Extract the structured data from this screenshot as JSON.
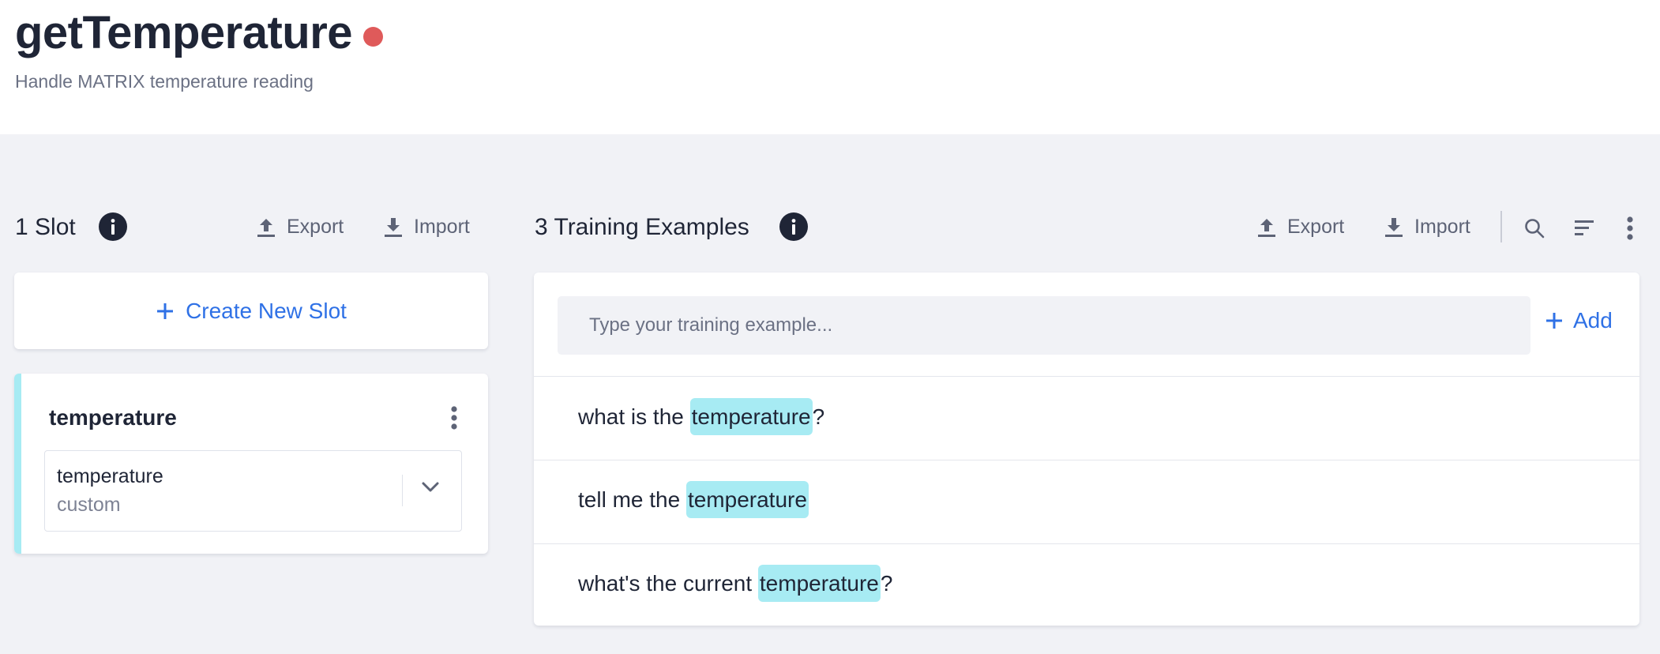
{
  "header": {
    "title": "getTemperature",
    "subtitle": "Handle MATRIX temperature reading",
    "status_color": "#df5a5a"
  },
  "slots_section": {
    "title": "1 Slot",
    "export_label": "Export",
    "import_label": "Import",
    "create_label": "Create New Slot",
    "slot": {
      "name": "temperature",
      "type_value": "temperature",
      "type_kind": "custom",
      "accent_color": "#a7ebf3"
    }
  },
  "training_section": {
    "title": "3 Training Examples",
    "export_label": "Export",
    "import_label": "Import",
    "input_placeholder": "Type your training example...",
    "add_label": "Add",
    "examples": [
      {
        "before": "what is the ",
        "slot": "temperature",
        "after": "?"
      },
      {
        "before": "tell me the ",
        "slot": "temperature",
        "after": ""
      },
      {
        "before": "what's the current ",
        "slot": "temperature",
        "after": "?"
      }
    ]
  },
  "icons": [
    "info-icon",
    "upload-icon",
    "download-icon",
    "search-icon",
    "sort-icon",
    "more-vertical-icon",
    "plus-icon",
    "chevron-down-icon"
  ],
  "colors": {
    "accent": "#2f71e6",
    "highlight": "#a7ebf3",
    "background": "#f1f2f6"
  }
}
